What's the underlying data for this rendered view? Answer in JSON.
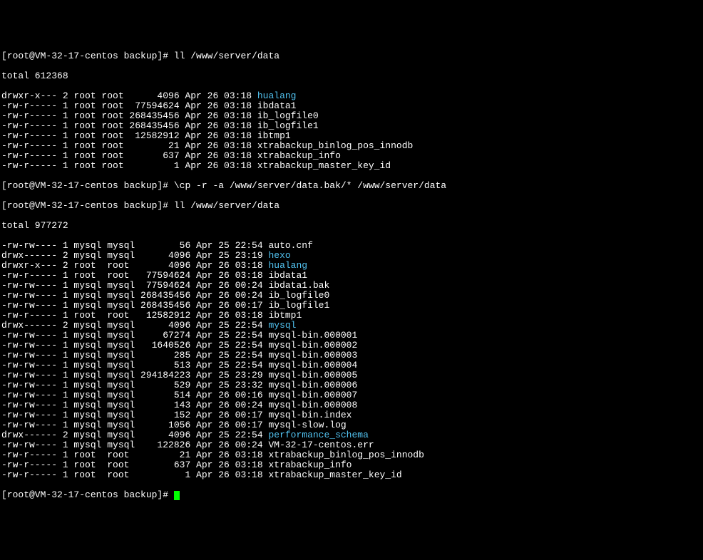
{
  "prompt1": "[root@VM-32-17-centos backup]# ",
  "cmd1": "ll /www/server/data",
  "total1": "total 612368",
  "list1": [
    {
      "perm": "drwxr-x--- 2 root root      4096 Apr 26 03:18 ",
      "name": "hualang",
      "dir": true
    },
    {
      "perm": "-rw-r----- 1 root root  77594624 Apr 26 03:18 ",
      "name": "ibdata1",
      "dir": false
    },
    {
      "perm": "-rw-r----- 1 root root 268435456 Apr 26 03:18 ",
      "name": "ib_logfile0",
      "dir": false
    },
    {
      "perm": "-rw-r----- 1 root root 268435456 Apr 26 03:18 ",
      "name": "ib_logfile1",
      "dir": false
    },
    {
      "perm": "-rw-r----- 1 root root  12582912 Apr 26 03:18 ",
      "name": "ibtmp1",
      "dir": false
    },
    {
      "perm": "-rw-r----- 1 root root        21 Apr 26 03:18 ",
      "name": "xtrabackup_binlog_pos_innodb",
      "dir": false
    },
    {
      "perm": "-rw-r----- 1 root root       637 Apr 26 03:18 ",
      "name": "xtrabackup_info",
      "dir": false
    },
    {
      "perm": "-rw-r----- 1 root root         1 Apr 26 03:18 ",
      "name": "xtrabackup_master_key_id",
      "dir": false
    }
  ],
  "prompt2": "[root@VM-32-17-centos backup]# ",
  "cmd2": "\\cp -r -a /www/server/data.bak/* /www/server/data",
  "prompt3": "[root@VM-32-17-centos backup]# ",
  "cmd3": "ll /www/server/data",
  "total2": "total 977272",
  "list2": [
    {
      "perm": "-rw-rw---- 1 mysql mysql        56 Apr 25 22:54 ",
      "name": "auto.cnf",
      "dir": false
    },
    {
      "perm": "drwx------ 2 mysql mysql      4096 Apr 25 23:19 ",
      "name": "hexo",
      "dir": true
    },
    {
      "perm": "drwxr-x--- 2 root  root       4096 Apr 26 03:18 ",
      "name": "hualang",
      "dir": true
    },
    {
      "perm": "-rw-r----- 1 root  root   77594624 Apr 26 03:18 ",
      "name": "ibdata1",
      "dir": false
    },
    {
      "perm": "-rw-rw---- 1 mysql mysql  77594624 Apr 26 00:24 ",
      "name": "ibdata1.bak",
      "dir": false
    },
    {
      "perm": "-rw-rw---- 1 mysql mysql 268435456 Apr 26 00:24 ",
      "name": "ib_logfile0",
      "dir": false
    },
    {
      "perm": "-rw-rw---- 1 mysql mysql 268435456 Apr 26 00:17 ",
      "name": "ib_logfile1",
      "dir": false
    },
    {
      "perm": "-rw-r----- 1 root  root   12582912 Apr 26 03:18 ",
      "name": "ibtmp1",
      "dir": false
    },
    {
      "perm": "drwx------ 2 mysql mysql      4096 Apr 25 22:54 ",
      "name": "mysql",
      "dir": true
    },
    {
      "perm": "-rw-rw---- 1 mysql mysql     67274 Apr 25 22:54 ",
      "name": "mysql-bin.000001",
      "dir": false
    },
    {
      "perm": "-rw-rw---- 1 mysql mysql   1640526 Apr 25 22:54 ",
      "name": "mysql-bin.000002",
      "dir": false
    },
    {
      "perm": "-rw-rw---- 1 mysql mysql       285 Apr 25 22:54 ",
      "name": "mysql-bin.000003",
      "dir": false
    },
    {
      "perm": "-rw-rw---- 1 mysql mysql       513 Apr 25 22:54 ",
      "name": "mysql-bin.000004",
      "dir": false
    },
    {
      "perm": "-rw-rw---- 1 mysql mysql 294184223 Apr 25 23:29 ",
      "name": "mysql-bin.000005",
      "dir": false
    },
    {
      "perm": "-rw-rw---- 1 mysql mysql       529 Apr 25 23:32 ",
      "name": "mysql-bin.000006",
      "dir": false
    },
    {
      "perm": "-rw-rw---- 1 mysql mysql       514 Apr 26 00:16 ",
      "name": "mysql-bin.000007",
      "dir": false
    },
    {
      "perm": "-rw-rw---- 1 mysql mysql       143 Apr 26 00:24 ",
      "name": "mysql-bin.000008",
      "dir": false
    },
    {
      "perm": "-rw-rw---- 1 mysql mysql       152 Apr 26 00:17 ",
      "name": "mysql-bin.index",
      "dir": false
    },
    {
      "perm": "-rw-rw---- 1 mysql mysql      1056 Apr 26 00:17 ",
      "name": "mysql-slow.log",
      "dir": false
    },
    {
      "perm": "drwx------ 2 mysql mysql      4096 Apr 25 22:54 ",
      "name": "performance_schema",
      "dir": true
    },
    {
      "perm": "-rw-rw---- 1 mysql mysql    122826 Apr 26 00:24 ",
      "name": "VM-32-17-centos.err",
      "dir": false
    },
    {
      "perm": "-rw-r----- 1 root  root         21 Apr 26 03:18 ",
      "name": "xtrabackup_binlog_pos_innodb",
      "dir": false
    },
    {
      "perm": "-rw-r----- 1 root  root        637 Apr 26 03:18 ",
      "name": "xtrabackup_info",
      "dir": false
    },
    {
      "perm": "-rw-r----- 1 root  root          1 Apr 26 03:18 ",
      "name": "xtrabackup_master_key_id",
      "dir": false
    }
  ],
  "prompt4": "[root@VM-32-17-centos backup]# "
}
